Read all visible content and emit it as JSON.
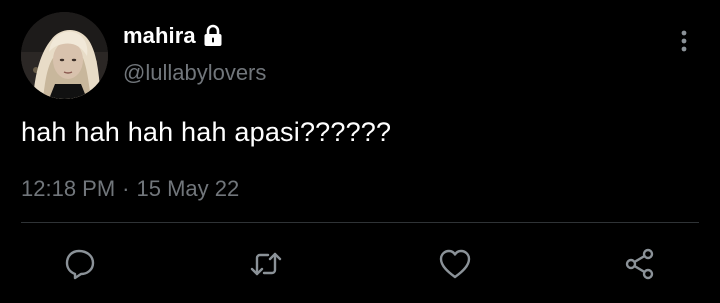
{
  "author": {
    "display_name": "mahira",
    "handle": "@lullabylovers",
    "avatar_icon": "profile-photo",
    "protected_icon": "lock-icon"
  },
  "tweet": {
    "text": "hah hah hah hah apasi??????",
    "time": "12:18 PM",
    "separator": "·",
    "date": "15 May 22"
  },
  "actions": {
    "reply_icon": "reply-icon",
    "retweet_icon": "retweet-icon",
    "like_icon": "like-icon",
    "share_icon": "share-icon",
    "more_icon": "more-vertical-icon"
  },
  "colors": {
    "background": "#000000",
    "primary_text": "#ffffff",
    "secondary_text": "#71767b",
    "divider": "#2f3336"
  }
}
